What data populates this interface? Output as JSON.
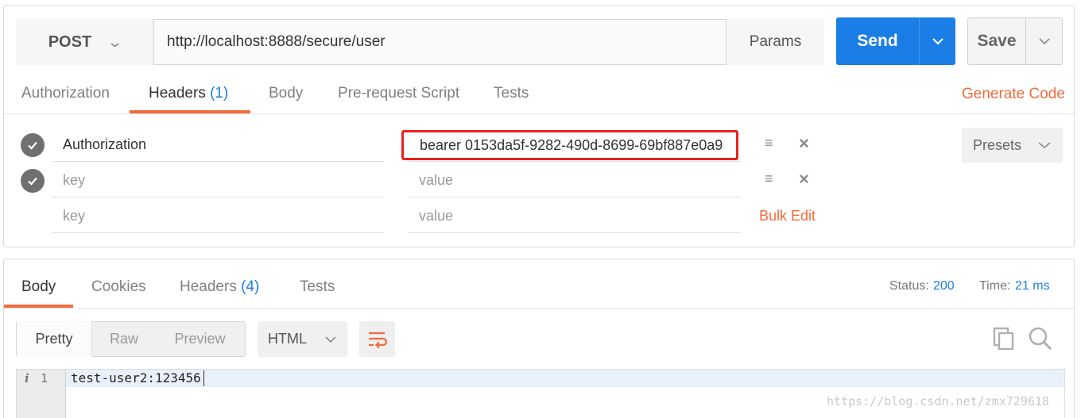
{
  "request": {
    "method": "POST",
    "url": "http://localhost:8888/secure/user",
    "params_label": "Params",
    "send_label": "Send",
    "save_label": "Save",
    "tabs": [
      {
        "label": "Authorization"
      },
      {
        "label": "Headers",
        "count": "(1)"
      },
      {
        "label": "Body"
      },
      {
        "label": "Pre-request Script"
      },
      {
        "label": "Tests"
      }
    ],
    "generate_code_label": "Generate Code",
    "headers": [
      {
        "key": "Authorization",
        "value": "bearer 0153da5f-9282-490d-8699-69bf887e0a9"
      },
      {
        "key_placeholder": "key",
        "value_placeholder": "value"
      },
      {
        "key_placeholder": "key",
        "value_placeholder": "value"
      }
    ],
    "bulk_edit_label": "Bulk Edit",
    "presets_label": "Presets"
  },
  "response": {
    "tabs": [
      {
        "label": "Body"
      },
      {
        "label": "Cookies"
      },
      {
        "label": "Headers",
        "count": "(4)"
      },
      {
        "label": "Tests"
      }
    ],
    "status_label": "Status:",
    "status_value": "200",
    "time_label": "Time:",
    "time_value": "21 ms",
    "view_modes": [
      "Pretty",
      "Raw",
      "Preview"
    ],
    "format": "HTML",
    "line_number": "1",
    "body_line": "test-user2:123456"
  },
  "watermark": "https://blog.csdn.net/zmx729618",
  "colors": {
    "accent": "#f26b3a",
    "primary": "#1a7ee6",
    "highlight_box": "#e8201f"
  }
}
